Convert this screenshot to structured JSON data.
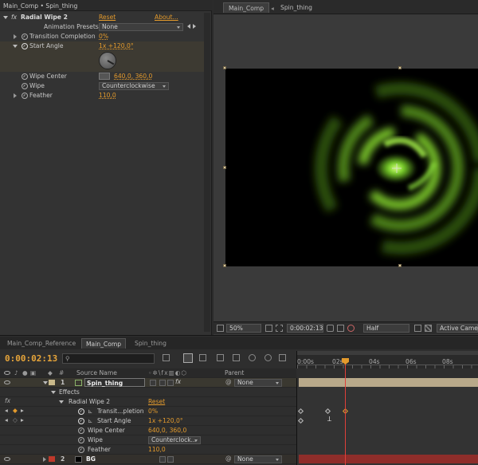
{
  "effect_controls": {
    "header": "Main_Comp • Spin_thing",
    "effect_name": "Radial Wipe 2",
    "fx_label": "fx",
    "reset": "Reset",
    "about": "About...",
    "presets_label": "Animation Presets:",
    "presets_value": "None",
    "props": [
      {
        "name": "Transition Completion",
        "value": "0%"
      },
      {
        "name": "Start Angle",
        "value": "1x +120,0°"
      },
      {
        "name": "Wipe Center",
        "value": "640,0, 360,0"
      },
      {
        "name": "Wipe",
        "value": "Counterclockwise"
      },
      {
        "name": "Feather",
        "value": "110,0"
      }
    ]
  },
  "viewer": {
    "tabs": [
      "Main_Comp",
      "Spin_thing"
    ],
    "zoom": "50%",
    "time": "0:00:02:13",
    "resolution": "Half",
    "camera": "Active Camera"
  },
  "timeline": {
    "tabs": [
      "Main_Comp_Reference",
      "Main_Comp",
      "Spin_thing"
    ],
    "timecode": "0:00:02:13",
    "col_source": "Source Name",
    "col_parent": "Parent",
    "ruler_ticks": [
      "0:00s",
      "02s",
      "04s",
      "06s",
      "08s"
    ],
    "layers": [
      {
        "num": "1",
        "name": "Spin_thing",
        "parent": "None"
      },
      {
        "num": "2",
        "name": "BG",
        "parent": "None"
      }
    ],
    "effects_label": "Effects",
    "effect_name": "Radial Wipe 2",
    "reset": "Reset",
    "props": [
      {
        "name": "Transit...pletion",
        "value": "0%"
      },
      {
        "name": "Start Angle",
        "value": "1x +120,0°"
      },
      {
        "name": "Wipe Center",
        "value": "640,0, 360,0"
      },
      {
        "name": "Wipe",
        "value": "Counterclock..."
      },
      {
        "name": "Feather",
        "value": "110,0"
      }
    ]
  },
  "colors": {
    "accent": "#e39a2c",
    "glow": "#7cd72a",
    "label_red": "#c0392b"
  }
}
